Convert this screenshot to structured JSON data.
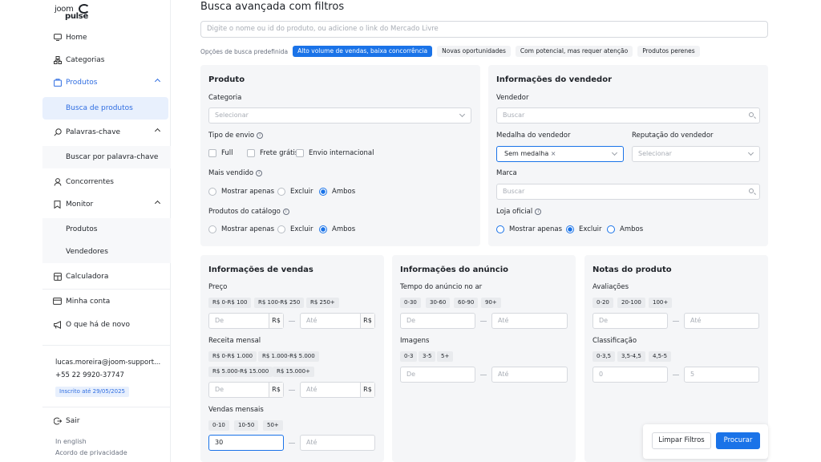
{
  "brand": {
    "line1": "joom",
    "line2": "pulse"
  },
  "sidebar": {
    "home": "Home",
    "categorias": "Categorias",
    "produtos": "Produtos",
    "busca_produtos": "Busca de produtos",
    "palavras": "Palavras-chave",
    "buscar_palavra": "Buscar por palavra-chave",
    "concorrentes": "Concorrentes",
    "monitor": "Monitor",
    "monitor_produtos": "Produtos",
    "monitor_vendedores": "Vendedores",
    "calculadora": "Calculadora",
    "minha_conta": "Minha conta",
    "novo": "O que há de novo",
    "email": "lucas.moreira@joom-support...",
    "phone": "+55 22 9920-37747",
    "badge": "Inscrito até 29/05/2025",
    "sair": "Sair",
    "lang": "In english",
    "privacy": "Acordo de privacidade"
  },
  "main": {
    "title": "Busca avançada com filtros",
    "search_placeholder": "Digite o nome ou id do produto, ou adicione o link do Mercado Livre",
    "presets_label": "Opções de busca predefinida",
    "presets": [
      "Alto volume de vendas, baixa concorrência",
      "Novas oportunidades",
      "Com potencial, mas requer atenção",
      "Produtos perenes"
    ]
  },
  "produto": {
    "title": "Produto",
    "categoria": "Categoria",
    "categoria_ph": "Selecionar",
    "envio": "Tipo de envio",
    "full": "Full",
    "frete": "Frete grátis",
    "internacional": "Envio internacional",
    "mais_vendido": "Mais vendido",
    "catalogo": "Produtos do catálogo",
    "mostrar": "Mostrar apenas",
    "excluir": "Excluir",
    "ambos": "Ambos"
  },
  "vendedor": {
    "title": "Informações do vendedor",
    "vendedor": "Vendedor",
    "buscar": "Buscar",
    "medalha": "Medalha do vendedor",
    "medalha_val": "Sem medalha",
    "reputacao": "Reputação do vendedor",
    "reputacao_ph": "Selecionar",
    "marca": "Marca",
    "loja": "Loja oficial",
    "mostrar": "Mostrar apenas",
    "excluir": "Excluir",
    "ambos": "Ambos"
  },
  "vendas": {
    "title": "Informações de vendas",
    "preco": "Preço",
    "preco_chips": [
      "R$ 0-R$ 100",
      "R$ 100-R$ 250",
      "R$ 250+"
    ],
    "de": "De",
    "ate": "Até",
    "rs": "R$",
    "receita": "Receita mensal",
    "receita_chips": [
      "R$ 0-R$ 1.000",
      "R$ 1.000-R$ 5.000",
      "R$ 5.000-R$ 15.000",
      "R$ 15.000+"
    ],
    "vendas_mensais": "Vendas mensais",
    "vendas_chips": [
      "0-10",
      "10-50",
      "50+"
    ],
    "vendas_val": "30"
  },
  "anuncio": {
    "title": "Informações do anúncio",
    "tempo": "Tempo do anúncio no ar",
    "tempo_chips": [
      "0-30",
      "30-60",
      "60-90",
      "90+"
    ],
    "imagens": "Imagens",
    "imagens_chips": [
      "0-3",
      "3-5",
      "5+"
    ],
    "de": "De",
    "ate": "Até"
  },
  "notas": {
    "title": "Notas do produto",
    "avaliacoes": "Avaliações",
    "aval_chips": [
      "0-20",
      "20-100",
      "100+"
    ],
    "classificacao": "Classificação",
    "class_chips": [
      "0-3,5",
      "3,5-4,5",
      "4,5-5"
    ],
    "de": "De",
    "ate": "Até",
    "class_de": "0",
    "class_ate": "5"
  },
  "actions": {
    "limpar": "Limpar Filtros",
    "procurar": "Procurar"
  }
}
